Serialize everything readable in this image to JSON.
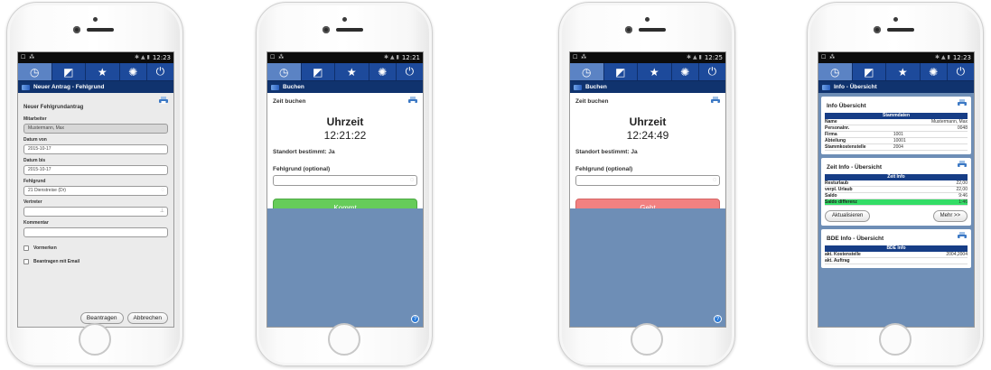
{
  "colors": {
    "toolbar": "#163d86",
    "titlebar": "#10336e",
    "kommt": "#66cc5a",
    "geht": "#f28181",
    "highlight": "#33dd66",
    "panel_bg": "#6e8eb6"
  },
  "toolbar_icons": [
    "clock-icon",
    "tag-icon",
    "star-icon",
    "gear-icon",
    "power-icon"
  ],
  "phones": [
    {
      "status": {
        "left": "☐ ⁂",
        "right": "12:23"
      },
      "title": "Neuer Antrag - Fehlgrund",
      "form": {
        "heading": "Neuer Fehlgrundantrag",
        "fields": [
          {
            "label": "Mitarbeiter",
            "value": "Mustermann, Max"
          },
          {
            "label": "Datum von",
            "value": "2015-10-17"
          },
          {
            "label": "Datum bis",
            "value": "2015-10-17"
          },
          {
            "label": "Fehlgrund",
            "value": "21 Dienstreise (Dr)"
          },
          {
            "label": "Vertreter",
            "value": ""
          },
          {
            "label": "Kommentar",
            "value": ""
          }
        ],
        "checkboxes": [
          "Vormerken",
          "Beantragen mit Email"
        ],
        "buttons": {
          "submit": "Beantragen",
          "cancel": "Abbrechen"
        }
      }
    },
    {
      "status": {
        "left": "☐ ⁂",
        "right": "12:21"
      },
      "title": "Buchen",
      "booking": {
        "label": "Zeit buchen",
        "uhrzeit": "Uhrzeit",
        "time": "12:21:22",
        "standort": "Standort bestimmt:  Ja",
        "fehlgrund": "Fehlgrund (optional)",
        "button": "Kommt"
      }
    },
    {
      "status": {
        "left": "☐ ⁂",
        "right": "12:25"
      },
      "title": "Buchen",
      "booking": {
        "label": "Zeit buchen",
        "uhrzeit": "Uhrzeit",
        "time": "12:24:49",
        "standort": "Standort bestimmt:  Ja",
        "fehlgrund": "Fehlgrund (optional)",
        "button": "Geht"
      }
    },
    {
      "status": {
        "left": "☐ ⁂",
        "right": "12:23"
      },
      "title": "Info - Übersicht",
      "overview": {
        "info": {
          "title": "Info Übersicht",
          "table_head": "Stammdaten",
          "rows": [
            [
              "Name",
              "Mustermann, Max"
            ],
            [
              "Personalnr.",
              "0048"
            ],
            [
              "Firma",
              "1001"
            ],
            [
              "Abteilung",
              "10001"
            ],
            [
              "Stammkostenstelle",
              "2004"
            ]
          ]
        },
        "zeit": {
          "title": "Zeit Info - Übersicht",
          "table_head": "Zeit Info",
          "rows": [
            [
              "Resturlaub",
              "22,00"
            ],
            [
              "verpl. Urlaub",
              "22,00"
            ],
            [
              "Saldo",
              "9:46"
            ],
            [
              "Saldo differenz",
              "1:46"
            ]
          ],
          "buttons": {
            "refresh": "Aktualisieren",
            "more": "Mehr >>"
          }
        },
        "bde": {
          "title": "BDE Info - Übersicht",
          "table_head": "BDE Info",
          "rows": [
            [
              "akt. Kostenstelle",
              "2004,2004"
            ],
            [
              "akt. Auftrag",
              ""
            ]
          ]
        }
      }
    }
  ]
}
